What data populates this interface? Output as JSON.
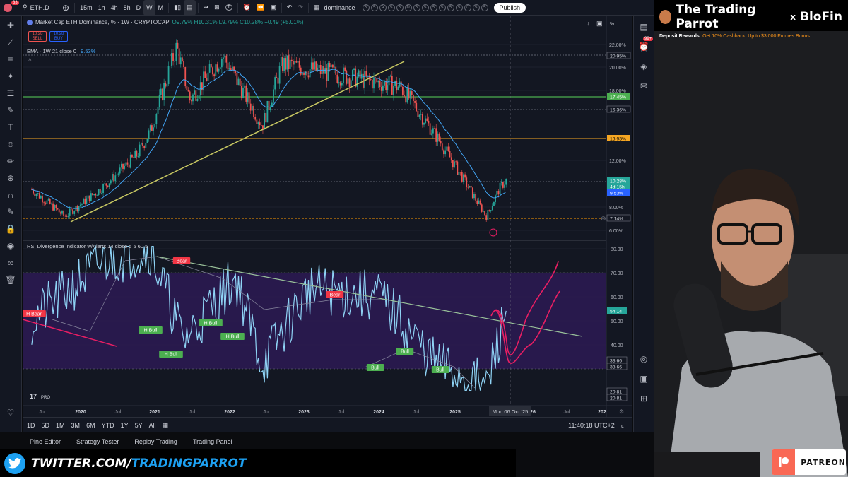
{
  "topbar": {
    "notification_count": "33",
    "symbol": "ETH.D",
    "intervals": [
      "15m",
      "1h",
      "4h",
      "8h",
      "D",
      "W",
      "M"
    ],
    "active_interval": "W",
    "indicator_search": "dominance",
    "alert_letters": [
      "S",
      "S",
      "A",
      "S",
      "S",
      "D",
      "S",
      "S",
      "S",
      "S",
      "S",
      "S",
      "C",
      "S",
      "S"
    ],
    "publish_label": "Publish"
  },
  "legend": {
    "title": "Market Cap ETH Dominance, % · 1W · CRYPTOCAP",
    "ohlc": "O9.79% H10.31% L9.79% C10.28% +0.49 (+5.01%)",
    "sell_price": "10.28",
    "sell_label": "SELL",
    "buy_price": "10.28",
    "buy_label": "BUY",
    "ema_label": "EMA · 1W 21 close 0",
    "ema_value": "9.53%"
  },
  "price_axis": {
    "unit": "%",
    "ticks": [
      "22.00%",
      "20.00%",
      "18.00%",
      "12.00%",
      "8.00%",
      "6.00%"
    ],
    "tags": [
      {
        "text": "20.95%",
        "bg": "#131722",
        "fg": "#d1d4dc",
        "border": "#787b86"
      },
      {
        "text": "17.45%",
        "bg": "#4caf50",
        "fg": "#fff"
      },
      {
        "text": "16.36%",
        "bg": "#131722",
        "fg": "#d1d4dc",
        "border": "#787b86"
      },
      {
        "text": "13.93%",
        "bg": "#f5a623",
        "fg": "#000"
      },
      {
        "text": "10.28%",
        "bg": "#26a69a",
        "fg": "#fff"
      },
      {
        "text": "4d 15h",
        "bg": "#26a69a",
        "fg": "#fff"
      },
      {
        "text": "9.53%",
        "bg": "#2962ff",
        "fg": "#fff"
      },
      {
        "text": "7.14%",
        "bg": "#131722",
        "fg": "#d1d4dc",
        "border": "#787b86"
      }
    ]
  },
  "rsi": {
    "title": "RSI Divergence Indicator w/Alerts 14 close 5 5 60 5",
    "ticks": [
      "80.00",
      "70.00",
      "60.00",
      "50.00",
      "40.00"
    ],
    "tags": [
      {
        "text": "54.14",
        "bg": "#26a69a",
        "fg": "#fff"
      },
      {
        "text": "33.66",
        "bg": "#131722",
        "fg": "#d1d4dc",
        "border": "#787b86"
      },
      {
        "text": "33.66",
        "bg": "#131722",
        "fg": "#d1d4dc",
        "border": "#787b86"
      },
      {
        "text": "20.81",
        "bg": "#131722",
        "fg": "#d1d4dc",
        "border": "#787b86"
      },
      {
        "text": "20.81",
        "bg": "#131722",
        "fg": "#d1d4dc",
        "border": "#787b86"
      }
    ],
    "labels": [
      {
        "text": "H Bear",
        "kind": "bear"
      },
      {
        "text": "Bear",
        "kind": "bear"
      },
      {
        "text": "Bear",
        "kind": "bear"
      },
      {
        "text": "H Bull",
        "kind": "bull"
      },
      {
        "text": "H Bull",
        "kind": "bull"
      },
      {
        "text": "H Bull",
        "kind": "bull"
      },
      {
        "text": "H Bull",
        "kind": "bull"
      },
      {
        "text": "Bull",
        "kind": "bull"
      },
      {
        "text": "Bull",
        "kind": "bull"
      },
      {
        "text": "Bull",
        "kind": "bull"
      }
    ],
    "tv_logo": "PRO"
  },
  "time_axis": {
    "labels": [
      "Jul",
      "2020",
      "Jul",
      "2021",
      "Jul",
      "2022",
      "Jul",
      "2023",
      "Jul",
      "2024",
      "Jul",
      "2025",
      "26",
      "Jul",
      "202"
    ],
    "crosshair_date": "Mon 06 Oct '25"
  },
  "bottombar": {
    "ranges": [
      "1D",
      "5D",
      "1M",
      "3M",
      "6M",
      "YTD",
      "1Y",
      "5Y",
      "All"
    ],
    "clock": "11:40:18 UTC+2"
  },
  "panels": [
    "Pine Editor",
    "Strategy Tester",
    "Replay Trading",
    "Trading Panel"
  ],
  "overlay": {
    "twitter_prefix": "TWITTER.COM/",
    "twitter_handle": "TRADINGPARROT",
    "brand_title": "The Trading Parrot",
    "brand_x": "x",
    "brand_partner": "BloFin",
    "deposit_prefix": "Deposit Rewards:",
    "deposit_offer": "Get 10% Cashback, Up to $3,000 Futures Bonus",
    "patreon": "PATREON",
    "right_badge": "99+"
  },
  "colors": {
    "up": "#26a69a",
    "down": "#ef5350",
    "rsi_line": "#8fd3f5",
    "rsi_band": "#3b1f66",
    "trend_yellow": "#c8c862",
    "hline_green": "#4caf50",
    "hline_orange": "#f5a623",
    "projection": "#e91e63"
  },
  "chart_data": {
    "type": "candlestick",
    "title": "Market Cap ETH Dominance, % · 1W · CRYPTOCAP",
    "ylabel": "%",
    "ylim": [
      5.5,
      23
    ],
    "key_points": [
      {
        "t": "2019-07",
        "v": 9.5
      },
      {
        "t": "2019-12",
        "v": 7.2
      },
      {
        "t": "2020-06",
        "v": 9.8
      },
      {
        "t": "2020-11",
        "v": 12.5
      },
      {
        "t": "2021-01",
        "v": 14.5
      },
      {
        "t": "2021-05",
        "v": 21.8
      },
      {
        "t": "2021-07",
        "v": 17.2
      },
      {
        "t": "2021-12",
        "v": 21.0
      },
      {
        "t": "2022-06",
        "v": 15.0
      },
      {
        "t": "2022-09",
        "v": 20.3
      },
      {
        "t": "2023-06",
        "v": 19.3
      },
      {
        "t": "2024-03",
        "v": 18.3
      },
      {
        "t": "2024-06",
        "v": 16.0
      },
      {
        "t": "2024-09",
        "v": 13.6
      },
      {
        "t": "2025-04",
        "v": 7.2
      },
      {
        "t": "2025-06",
        "v": 9.6
      },
      {
        "t": "2025-07",
        "v": 10.28
      }
    ],
    "hlines": [
      20.95,
      17.45,
      16.36,
      13.93,
      7.14
    ],
    "rsi": {
      "ylim": [
        20,
        82
      ],
      "overbought": 70,
      "oversold": 33.66,
      "key_points": [
        {
          "t": "2019-07",
          "v": 50
        },
        {
          "t": "2020-06",
          "v": 75
        },
        {
          "t": "2021-01",
          "v": 80
        },
        {
          "t": "2021-06",
          "v": 42
        },
        {
          "t": "2022-02",
          "v": 68
        },
        {
          "t": "2022-06",
          "v": 32
        },
        {
          "t": "2023-01",
          "v": 63
        },
        {
          "t": "2023-12",
          "v": 60
        },
        {
          "t": "2024-08",
          "v": 33
        },
        {
          "t": "2025-04",
          "v": 22
        },
        {
          "t": "2025-07",
          "v": 54.14
        }
      ]
    }
  }
}
